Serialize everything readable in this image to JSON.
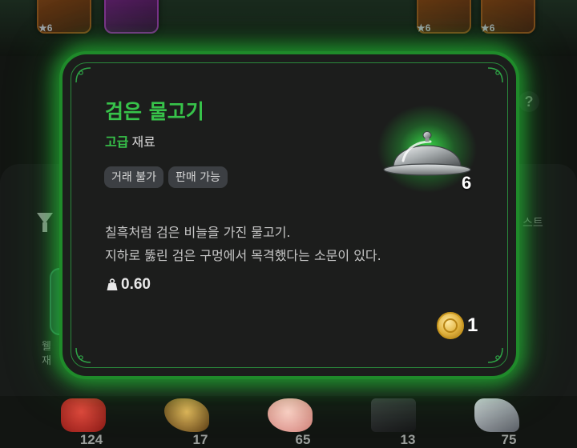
{
  "background": {
    "top_cards": [
      {
        "stars": "★6"
      },
      {
        "stars": "★6"
      },
      {
        "stars": "★6"
      }
    ],
    "help_label": "?",
    "left_label": "웰\n재",
    "right_label": "스트",
    "materials": [
      {
        "icon": "ruby-ore-icon",
        "count": "124",
        "color": "#c2302a"
      },
      {
        "icon": "golden-feather-icon",
        "count": "17",
        "color": "#b98a3a"
      },
      {
        "icon": "pink-bean-icon",
        "count": "65",
        "color": "#f0a7a0"
      },
      {
        "icon": "dark-crate-icon",
        "count": "13",
        "color": "#2c2e2f"
      },
      {
        "icon": "crystal-rock-icon",
        "count": "75",
        "color": "#8a9098"
      }
    ]
  },
  "item": {
    "name": "검은 물고기",
    "grade": "고급",
    "type": "재료",
    "tags": [
      "거래 불가",
      "판매 가능"
    ],
    "description": [
      "칠흑처럼 검은 비늘을 가진 물고기.",
      "지하로 뚫린 검은 구멍에서 목격했다는 소문이 있다."
    ],
    "weight": "0.60",
    "count": "6",
    "price": "1",
    "icon": "cloche-icon",
    "colors": {
      "grade": "#37c34a",
      "border": "#1f8a2a",
      "glow": "#3cff50"
    }
  }
}
